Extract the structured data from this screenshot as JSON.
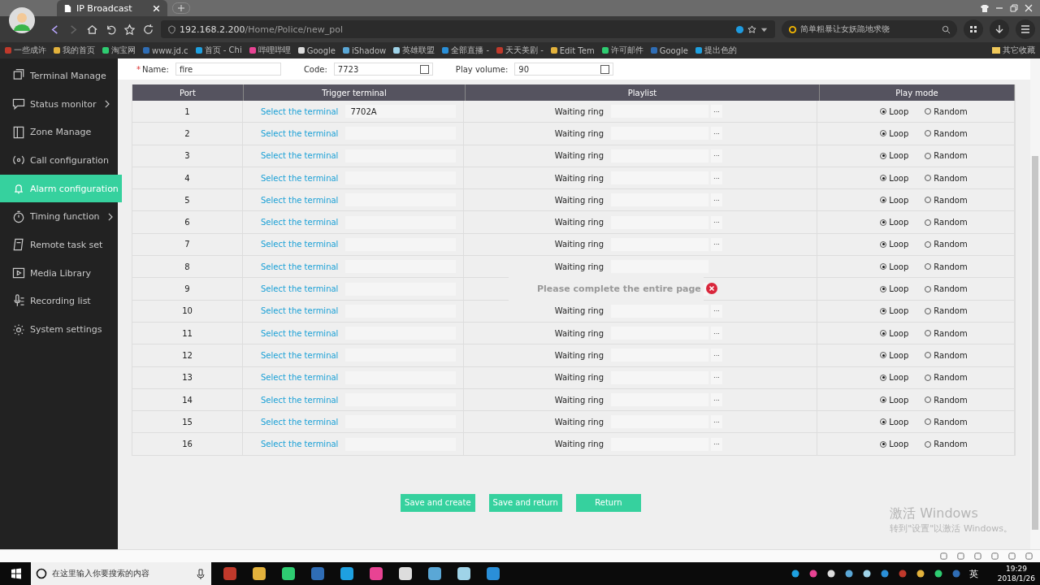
{
  "browser": {
    "tab_title": "IP Broadcast",
    "url_host": "192.168.2.200",
    "url_path": "/Home/Police/new_pol",
    "search_placeholder": "简单粗暴让女妖跪地求饶",
    "bookmarks": [
      "一些成许",
      "我的首页",
      "淘宝网",
      "www.jd.c",
      "首页 - Chi",
      "哔哩哔哩",
      "Google",
      "iShadow",
      "英雄联盟",
      "全部直播 -",
      "天天美剧 -",
      "Edit Tem",
      "许可邮件",
      "Google",
      "提出色的"
    ],
    "other_bookmarks": "其它收藏"
  },
  "sidebar": {
    "items": [
      {
        "label": "Terminal Manage",
        "selected": false,
        "has_submenu": false
      },
      {
        "label": "Status monitor",
        "selected": false,
        "has_submenu": true
      },
      {
        "label": "Zone Manage",
        "selected": false,
        "has_submenu": false
      },
      {
        "label": "Call configuration",
        "selected": false,
        "has_submenu": false
      },
      {
        "label": "Alarm configuration",
        "selected": true,
        "has_submenu": false
      },
      {
        "label": "Timing function",
        "selected": false,
        "has_submenu": true
      },
      {
        "label": "Remote task set",
        "selected": false,
        "has_submenu": false
      },
      {
        "label": "Media Library",
        "selected": false,
        "has_submenu": false
      },
      {
        "label": "Recording list",
        "selected": false,
        "has_submenu": false
      },
      {
        "label": "System settings",
        "selected": false,
        "has_submenu": false
      }
    ]
  },
  "form": {
    "required_mark": "*",
    "name_label": "Name:",
    "name_value": "fire",
    "code_label": "Code:",
    "code_value": "7723",
    "volume_label": "Play volume:",
    "volume_value": "90"
  },
  "table": {
    "columns": [
      "Port",
      "Trigger terminal",
      "Playlist",
      "Play mode"
    ],
    "rows": [
      {
        "port": "1",
        "trigger": "Select the terminal",
        "terminal": "7702A",
        "playlist": "Waiting ring",
        "browse": "···",
        "modes": [
          {
            "label": "Loop",
            "selected": true
          },
          {
            "label": "Random",
            "selected": false
          }
        ]
      },
      {
        "port": "2",
        "trigger": "Select the terminal",
        "playlist": "Waiting ring",
        "browse": "···",
        "modes": [
          {
            "label": "Loop",
            "selected": true
          },
          {
            "label": "Random",
            "selected": false
          }
        ]
      },
      {
        "port": "3",
        "trigger": "Select the terminal",
        "playlist": "Waiting ring",
        "browse": "···",
        "modes": [
          {
            "label": "Loop",
            "selected": true
          },
          {
            "label": "Random",
            "selected": false
          }
        ]
      },
      {
        "port": "4",
        "trigger": "Select the terminal",
        "playlist": "Waiting ring",
        "browse": "···",
        "modes": [
          {
            "label": "Loop",
            "selected": true
          },
          {
            "label": "Random",
            "selected": false
          }
        ]
      },
      {
        "port": "5",
        "trigger": "Select the terminal",
        "playlist": "Waiting ring",
        "browse": "···",
        "modes": [
          {
            "label": "Loop",
            "selected": true
          },
          {
            "label": "Random",
            "selected": false
          }
        ]
      },
      {
        "port": "6",
        "trigger": "Select the terminal",
        "playlist": "Waiting ring",
        "browse": "···",
        "modes": [
          {
            "label": "Loop",
            "selected": true
          },
          {
            "label": "Random",
            "selected": false
          }
        ]
      },
      {
        "port": "7",
        "trigger": "Select the terminal",
        "playlist": "Waiting ring",
        "browse": "···",
        "modes": [
          {
            "label": "Loop",
            "selected": true
          },
          {
            "label": "Random",
            "selected": false
          }
        ]
      },
      {
        "port": "8",
        "trigger": "Select the terminal",
        "playlist": "Waiting ring",
        "modes": [
          {
            "label": "Loop",
            "selected": true
          },
          {
            "label": "Random",
            "selected": false
          }
        ]
      },
      {
        "port": "9",
        "trigger": "Select the terminal",
        "toast": "Please complete the entire page",
        "modes": [
          {
            "label": "Loop",
            "selected": true
          },
          {
            "label": "Random",
            "selected": false
          }
        ]
      },
      {
        "port": "10",
        "trigger": "Select the terminal",
        "playlist": "Waiting ring",
        "browse": "···",
        "modes": [
          {
            "label": "Loop",
            "selected": true
          },
          {
            "label": "Random",
            "selected": false
          }
        ]
      },
      {
        "port": "11",
        "trigger": "Select the terminal",
        "playlist": "Waiting ring",
        "browse": "···",
        "modes": [
          {
            "label": "Loop",
            "selected": true
          },
          {
            "label": "Random",
            "selected": false
          }
        ]
      },
      {
        "port": "12",
        "trigger": "Select the terminal",
        "playlist": "Waiting ring",
        "browse": "···",
        "modes": [
          {
            "label": "Loop",
            "selected": true
          },
          {
            "label": "Random",
            "selected": false
          }
        ]
      },
      {
        "port": "13",
        "trigger": "Select the terminal",
        "playlist": "Waiting ring",
        "browse": "···",
        "modes": [
          {
            "label": "Loop",
            "selected": true
          },
          {
            "label": "Random",
            "selected": false
          }
        ]
      },
      {
        "port": "14",
        "trigger": "Select the terminal",
        "playlist": "Waiting ring",
        "browse": "···",
        "modes": [
          {
            "label": "Loop",
            "selected": true
          },
          {
            "label": "Random",
            "selected": false
          }
        ]
      },
      {
        "port": "15",
        "trigger": "Select the terminal",
        "playlist": "Waiting ring",
        "browse": "···",
        "modes": [
          {
            "label": "Loop",
            "selected": true
          },
          {
            "label": "Random",
            "selected": false
          }
        ]
      },
      {
        "port": "16",
        "trigger": "Select the terminal",
        "playlist": "Waiting ring",
        "browse": "···",
        "modes": [
          {
            "label": "Loop",
            "selected": true
          },
          {
            "label": "Random",
            "selected": false
          }
        ]
      }
    ]
  },
  "buttons": [
    "Save and create",
    "Save and return",
    "Return"
  ],
  "os_watermark": {
    "title": "激活 Windows",
    "subtitle": "转到\"设置\"以激活 Windows。"
  },
  "taskbar": {
    "search_placeholder": "在这里输入你要搜索的内容",
    "ime": "英",
    "time": "19:29",
    "date": "2018/1/26"
  }
}
